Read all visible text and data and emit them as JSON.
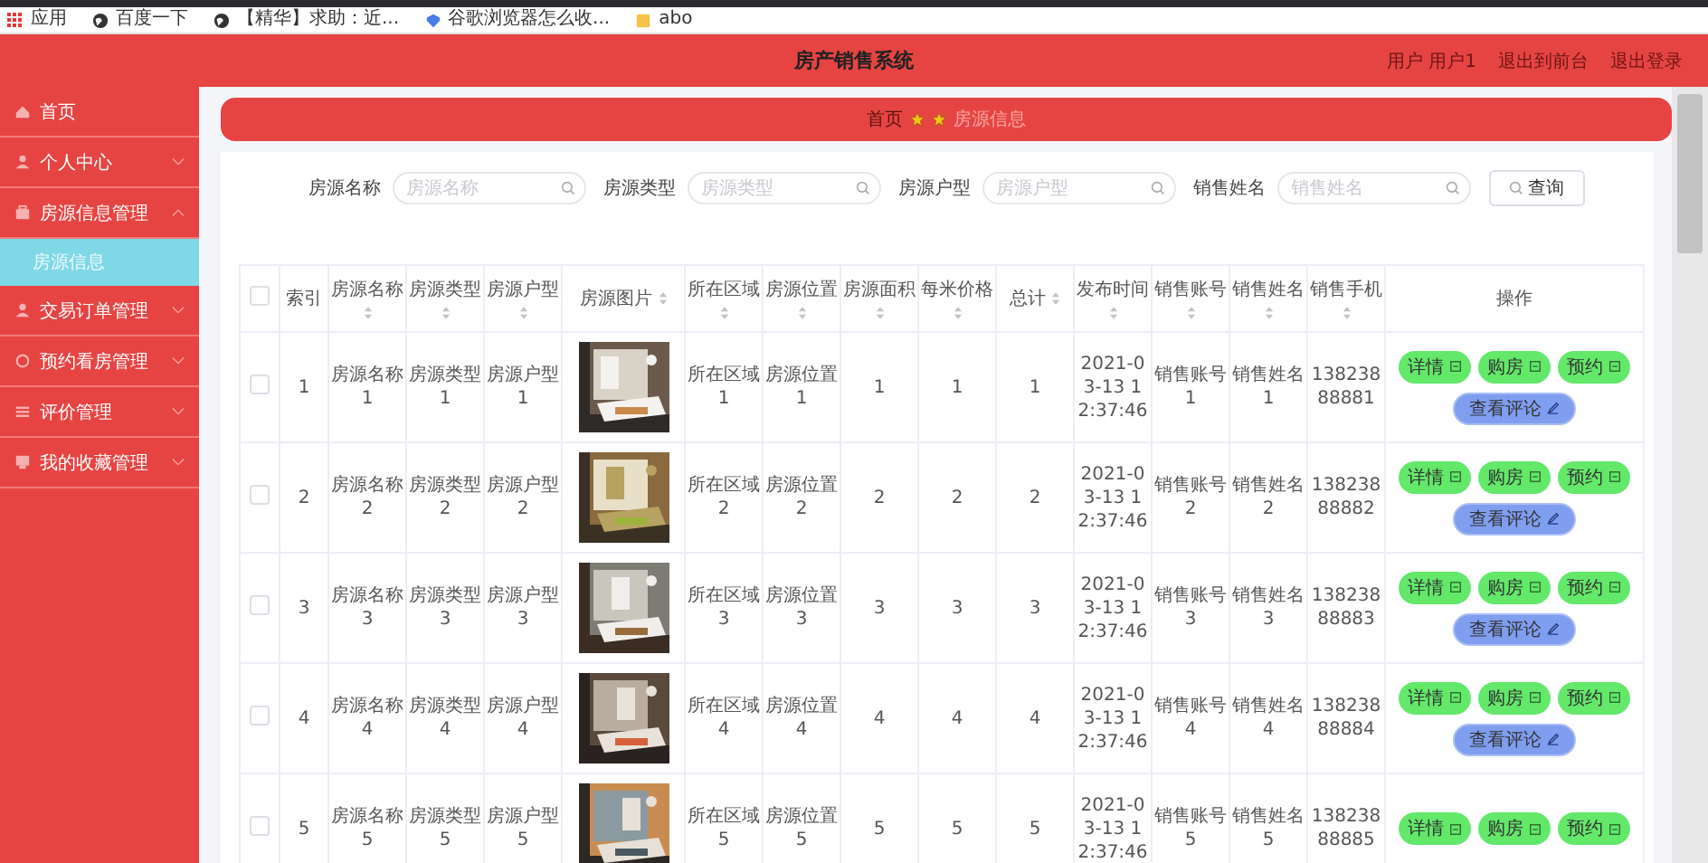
{
  "bookmarks": [
    {
      "label": "应用",
      "kind": "apps"
    },
    {
      "label": "百度一下",
      "kind": "globe"
    },
    {
      "label": "【精华】求助：近...",
      "kind": "globe"
    },
    {
      "label": "谷歌浏览器怎么收...",
      "kind": "link"
    },
    {
      "label": "abo",
      "kind": "folder"
    }
  ],
  "header": {
    "title": "房产销售系统",
    "links": [
      "用户 用户1",
      "退出到前台",
      "退出登录"
    ]
  },
  "sidebar": {
    "items": [
      {
        "label": "首页",
        "kind": "link"
      },
      {
        "label": "个人中心",
        "kind": "menu",
        "expanded": false
      },
      {
        "label": "房源信息管理",
        "kind": "menu",
        "expanded": true,
        "children": [
          {
            "label": "房源信息",
            "selected": true
          }
        ]
      },
      {
        "label": "交易订单管理",
        "kind": "menu",
        "expanded": false
      },
      {
        "label": "预约看房管理",
        "kind": "menu",
        "expanded": false
      },
      {
        "label": "评价管理",
        "kind": "menu",
        "expanded": false
      },
      {
        "label": "我的收藏管理",
        "kind": "menu",
        "expanded": false
      }
    ]
  },
  "breadcrumb": [
    "首页",
    "房源信息"
  ],
  "search": {
    "fields": [
      {
        "label": "房源名称",
        "placeholder": "房源名称"
      },
      {
        "label": "房源类型",
        "placeholder": "房源类型"
      },
      {
        "label": "房源户型",
        "placeholder": "房源户型"
      },
      {
        "label": "销售姓名",
        "placeholder": "销售姓名"
      }
    ],
    "button": "查询"
  },
  "table": {
    "select_all": {
      "checked": false
    },
    "columns": [
      {
        "label": "索引",
        "kind": "text",
        "sortable": false
      },
      {
        "label": "房源名称",
        "kind": "text",
        "sortable": true
      },
      {
        "label": "房源类型",
        "kind": "text",
        "sortable": true
      },
      {
        "label": "房源户型",
        "kind": "text",
        "sortable": true
      },
      {
        "label": "房源图片",
        "sortable": true
      },
      {
        "label": "所在区域",
        "kind": "text",
        "sortable": true
      },
      {
        "label": "房源位置",
        "kind": "text",
        "sortable": true
      },
      {
        "label": "房源面积",
        "kind": "text",
        "sortable": true
      },
      {
        "label": "每米价格",
        "kind": "text",
        "sortable": true
      },
      {
        "label": "总计",
        "kind": "text",
        "sortable": true
      },
      {
        "label": "发布时间",
        "kind": "text",
        "sortable": true
      },
      {
        "label": "销售账号",
        "kind": "text",
        "sortable": true
      },
      {
        "label": "销售姓名",
        "kind": "text",
        "sortable": true
      },
      {
        "label": "销售手机",
        "kind": "text",
        "sortable": true
      },
      {
        "label": "操作",
        "kind": "actions",
        "sortable": false
      }
    ],
    "rows": [
      {
        "checked": false,
        "cells": [
          "1",
          "房源名称1",
          "房源类型1",
          "房源户型1",
          {
            "kind": "picture"
          },
          "所在区域1",
          "房源位置1",
          "1",
          "1",
          "1",
          "2021-03-13 12:37:46",
          "销售账号1",
          "销售姓名1",
          "13823888881"
        ],
        "actions": [
          {
            "label": "详情",
            "kind": "success"
          },
          {
            "label": "购房",
            "kind": "success"
          },
          {
            "label": "预约",
            "kind": "success"
          },
          {
            "label": "查看评论",
            "kind": "primary"
          }
        ]
      },
      {
        "checked": false,
        "cells": [
          "2",
          "房源名称2",
          "房源类型2",
          "房源户型2",
          {
            "kind": "picture"
          },
          "所在区域2",
          "房源位置2",
          "2",
          "2",
          "2",
          "2021-03-13 12:37:46",
          "销售账号2",
          "销售姓名2",
          "13823888882"
        ],
        "actions": [
          {
            "label": "详情",
            "kind": "success"
          },
          {
            "label": "购房",
            "kind": "success"
          },
          {
            "label": "预约",
            "kind": "success"
          },
          {
            "label": "查看评论",
            "kind": "primary"
          }
        ]
      },
      {
        "checked": false,
        "cells": [
          "3",
          "房源名称3",
          "房源类型3",
          "房源户型3",
          {
            "kind": "picture"
          },
          "所在区域3",
          "房源位置3",
          "3",
          "3",
          "3",
          "2021-03-13 12:37:46",
          "销售账号3",
          "销售姓名3",
          "13823888883"
        ],
        "actions": [
          {
            "label": "详情",
            "kind": "success"
          },
          {
            "label": "购房",
            "kind": "success"
          },
          {
            "label": "预约",
            "kind": "success"
          },
          {
            "label": "查看评论",
            "kind": "primary"
          }
        ]
      },
      {
        "checked": false,
        "cells": [
          "4",
          "房源名称4",
          "房源类型4",
          "房源户型4",
          {
            "kind": "picture"
          },
          "所在区域4",
          "房源位置4",
          "4",
          "4",
          "4",
          "2021-03-13 12:37:46",
          "销售账号4",
          "销售姓名4",
          "13823888884"
        ],
        "actions": [
          {
            "label": "详情",
            "kind": "success"
          },
          {
            "label": "购房",
            "kind": "success"
          },
          {
            "label": "预约",
            "kind": "success"
          },
          {
            "label": "查看评论",
            "kind": "primary"
          }
        ]
      },
      {
        "checked": false,
        "cells": [
          "5",
          "房源名称5",
          "房源类型5",
          "房源户型5",
          {
            "kind": "picture"
          },
          "所在区域5",
          "房源位置5",
          "5",
          "5",
          "5",
          "2021-03-13 12:37:46",
          "销售账号5",
          "销售姓名5",
          "13823888885"
        ],
        "actions": [
          {
            "label": "详情",
            "kind": "success"
          },
          {
            "label": "购房",
            "kind": "success"
          },
          {
            "label": "预约",
            "kind": "success"
          }
        ]
      }
    ]
  }
}
